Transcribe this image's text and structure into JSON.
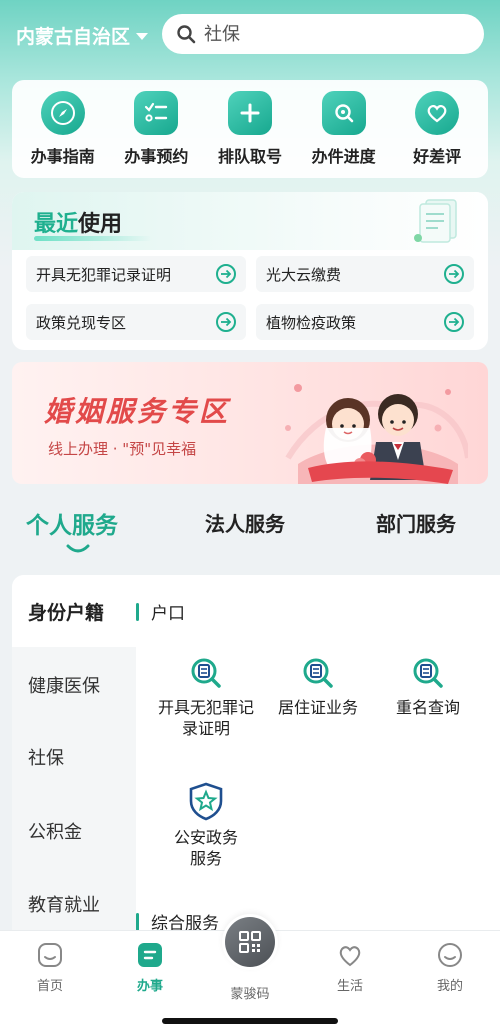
{
  "header": {
    "region": "内蒙古自治区",
    "search_placeholder": "社保"
  },
  "quick_actions": [
    {
      "label": "办事指南",
      "icon": "compass-icon"
    },
    {
      "label": "办事预约",
      "icon": "checklist-icon"
    },
    {
      "label": "排队取号",
      "icon": "queue-ticket-icon"
    },
    {
      "label": "办件进度",
      "icon": "progress-search-icon"
    },
    {
      "label": "好差评",
      "icon": "heart-icon"
    }
  ],
  "recent": {
    "title_highlight": "最近",
    "title_rest": "使用",
    "items": [
      {
        "label": "开具无犯罪记录证明"
      },
      {
        "label": "光大云缴费"
      },
      {
        "label": "政策兑现专区"
      },
      {
        "label": "植物检疫政策"
      }
    ]
  },
  "banner": {
    "title": "婚姻服务专区",
    "subtitle": "线上办理 · \"预\"见幸福"
  },
  "service_tabs": {
    "personal": "个人服务",
    "legal": "法人服务",
    "department": "部门服务",
    "active": "personal"
  },
  "sidebar": {
    "items": [
      {
        "label": "身份户籍"
      },
      {
        "label": "健康医保"
      },
      {
        "label": "社保"
      },
      {
        "label": "公积金"
      },
      {
        "label": "教育就业"
      }
    ]
  },
  "content": {
    "section1_title": "户口",
    "services": [
      {
        "label": "开具无犯罪记录证明",
        "icon": "document-search-icon"
      },
      {
        "label": "居住证业务",
        "icon": "document-search-icon"
      },
      {
        "label": "重名查询",
        "icon": "document-search-icon"
      },
      {
        "label": "公安政务服务",
        "icon": "police-shield-icon"
      }
    ],
    "section2_title": "综合服务"
  },
  "bottom_nav": {
    "items": [
      {
        "label": "首页"
      },
      {
        "label": "办事"
      },
      {
        "label": "蒙骏码"
      },
      {
        "label": "生活"
      },
      {
        "label": "我的"
      }
    ],
    "active": "办事"
  },
  "colors": {
    "accent": "#1fa98c",
    "banner_red": "#e24a4a"
  }
}
